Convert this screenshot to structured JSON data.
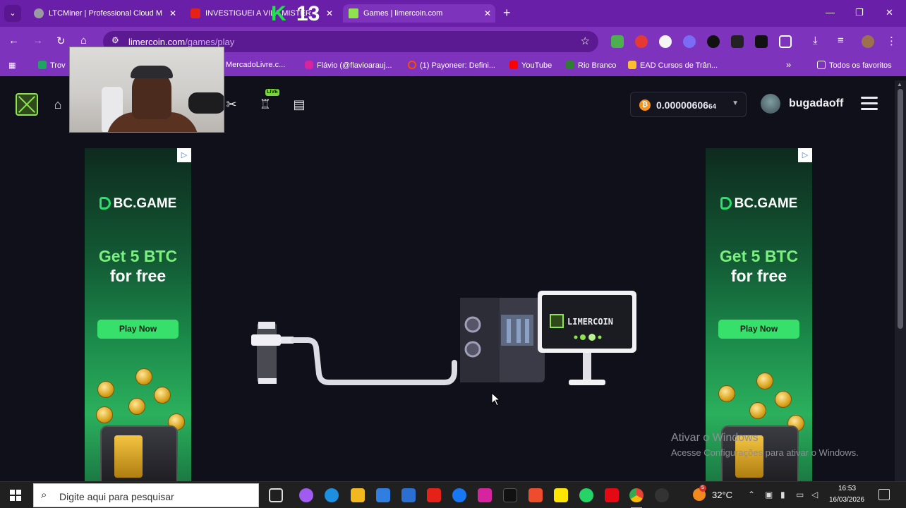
{
  "browser": {
    "tabs": [
      {
        "title": "LTCMiner | Professional Cloud M",
        "favicon_color": "#9a9aa0"
      },
      {
        "title": "INVESTIGUEI A VILA MISTÉR",
        "favicon_color": "#e62117"
      },
      {
        "title": "Games | limercoin.com",
        "favicon_color": "#8fe34e",
        "active": true
      }
    ],
    "tab_close": "✕",
    "new_tab": "+",
    "address": {
      "host": "limercoin.com",
      "path": "/games/play"
    },
    "bookmarks": [
      {
        "label": "Trov",
        "color": "#1fa463"
      },
      {
        "label": "| MercadoLivre.c...",
        "color": "#ffe600"
      },
      {
        "label": "Flávio (@flavioarauj...",
        "color": "#d6249f"
      },
      {
        "label": "(1) Payoneer: Defini...",
        "color": "#ff4800"
      },
      {
        "label": "YouTube",
        "color": "#ff0000"
      },
      {
        "label": "Rio Branco",
        "color": "#2e7d32"
      },
      {
        "label": "EAD Cursos de Trân...",
        "color": "#1976d2"
      }
    ],
    "bookmarks_more": "»",
    "all_bookmarks": "Todos os favoritos"
  },
  "overlay": {
    "k13_letter": "K",
    "k13_number": "13"
  },
  "site": {
    "live_badge": "LIVE",
    "balance": "0.00000606",
    "balance_small": "64",
    "username": "bugadaoff"
  },
  "ads": {
    "brand": "BC.GAME",
    "headline": "Get 5 BTC",
    "subline": "for free",
    "cta": "Play Now",
    "badge": "▷"
  },
  "game": {
    "monitor_label": "LIMERCOIN"
  },
  "watermark": {
    "line1": "Ativar o Windows",
    "line2": "Acesse Configurações para ativar o Windows."
  },
  "taskbar": {
    "search_placeholder": "Digite aqui para pesquisar",
    "weather_count": "5",
    "temperature": "32°C",
    "time": "16:53",
    "date": "16/03/2026"
  },
  "colors": {
    "brand_green": "#8fe34e",
    "browser_purple": "#7e33bd",
    "page_bg": "#0f1019"
  }
}
